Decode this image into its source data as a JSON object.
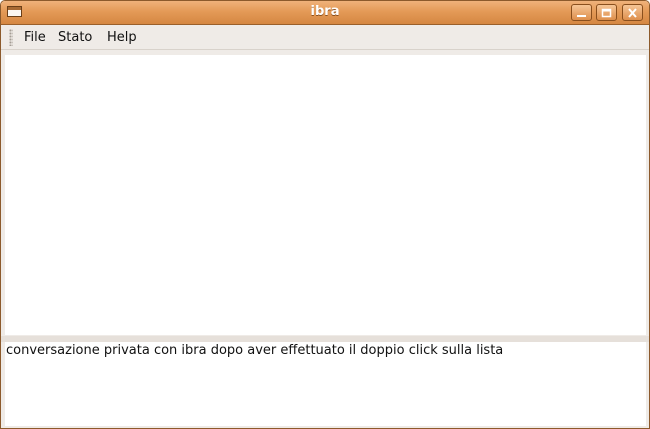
{
  "window": {
    "title": "ibra"
  },
  "menubar": {
    "items": [
      {
        "label": "File"
      },
      {
        "label": "Stato"
      },
      {
        "label": "Help"
      }
    ]
  },
  "chat": {
    "conversation_text": ""
  },
  "message": {
    "text": "conversazione privata con ibra dopo aver effettuato il doppio click sulla lista"
  },
  "colors": {
    "titlebar_accent": "#e49a57"
  },
  "icons": [
    "window-menu-icon",
    "minimize-icon",
    "maximize-icon",
    "close-icon"
  ]
}
